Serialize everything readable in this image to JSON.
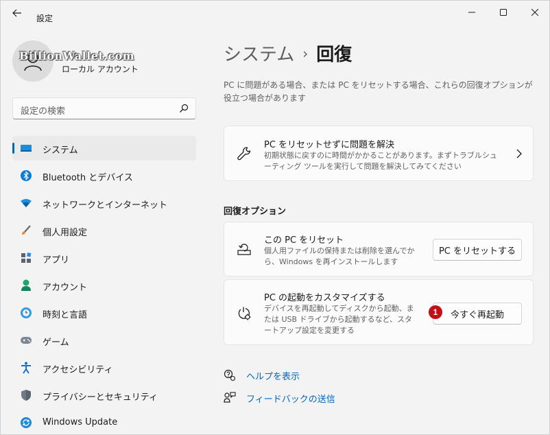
{
  "window": {
    "title": "設定",
    "controls": [
      "minimize-icon",
      "maximize-icon",
      "close-icon"
    ]
  },
  "profile": {
    "watermark": "BillionWallet.com",
    "account_type": "ローカル アカウント"
  },
  "search": {
    "placeholder": "設定の検索"
  },
  "sidebar": {
    "items": [
      {
        "label": "システム",
        "icon": "system-icon",
        "selected": true
      },
      {
        "label": "Bluetooth とデバイス",
        "icon": "bluetooth-icon"
      },
      {
        "label": "ネットワークとインターネット",
        "icon": "network-icon"
      },
      {
        "label": "個人用設定",
        "icon": "brush-icon"
      },
      {
        "label": "アプリ",
        "icon": "apps-icon"
      },
      {
        "label": "アカウント",
        "icon": "account-icon"
      },
      {
        "label": "時刻と言語",
        "icon": "clock-globe-icon"
      },
      {
        "label": "ゲーム",
        "icon": "gamepad-icon"
      },
      {
        "label": "アクセシビリティ",
        "icon": "accessibility-icon"
      },
      {
        "label": "プライバシーとセキュリティ",
        "icon": "shield-icon"
      },
      {
        "label": "Windows Update",
        "icon": "update-icon"
      }
    ]
  },
  "main": {
    "breadcrumb_parent": "システム",
    "breadcrumb_separator": "›",
    "breadcrumb_current": "回復",
    "description": "PC に問題がある場合、または PC をリセットする場合、これらの回復オプションが役立つ場合があります",
    "troubleshoot_card": {
      "title": "PC をリセットせずに問題を解決",
      "subtitle": "初期状態に戻すのに時間がかかることがあります。まずトラブルシューティング ツールを実行して問題を解決してみてください"
    },
    "section_heading": "回復オプション",
    "reset_card": {
      "title": "この PC をリセット",
      "subtitle": "個人用ファイルの保持または削除を選んでから、Windows を再インストールします",
      "button": "PC をリセットする"
    },
    "startup_card": {
      "title": "PC の起動をカスタマイズする",
      "subtitle": "デバイスを再起動してディスクから起動、または USB ドライブから起動するなど、スタートアップ設定を変更する",
      "button": "今すぐ再起動",
      "marker": "1"
    },
    "links": {
      "help": "ヘルプを表示",
      "feedback": "フィードバックの送信"
    }
  },
  "colors": {
    "accent": "#0067c0",
    "marker": "#c40f16",
    "background": "#f3f3f3",
    "card": "#fbfbfb"
  }
}
